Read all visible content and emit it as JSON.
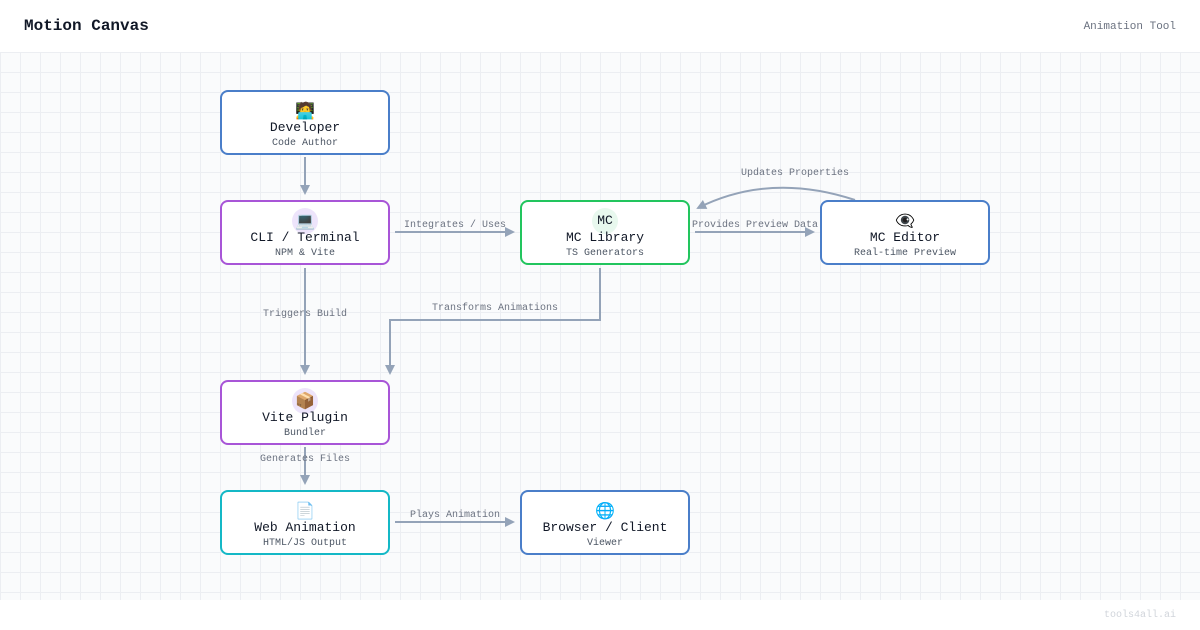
{
  "header": {
    "title": "Motion Canvas",
    "subtitle": "Animation Tool"
  },
  "footer": {
    "watermark": "tools4all.ai"
  },
  "nodes": {
    "developer": {
      "icon": "🧑‍💻",
      "icon_name": "developer-icon",
      "name": "Developer",
      "desc": "Code Author"
    },
    "cli": {
      "icon": "💻",
      "icon_name": "laptop-icon",
      "name": "CLI / Terminal",
      "desc": "NPM & Vite"
    },
    "library": {
      "icon": "MC",
      "icon_name": "mc-logo-icon",
      "name": "MC Library",
      "desc": "TS Generators"
    },
    "editor": {
      "icon": "👁‍🗨",
      "icon_name": "eye-icon",
      "name": "MC Editor",
      "desc": "Real-time Preview"
    },
    "vite": {
      "icon": "📦",
      "icon_name": "package-icon",
      "name": "Vite Plugin",
      "desc": "Bundler"
    },
    "web": {
      "icon": "📄",
      "icon_name": "document-icon",
      "name": "Web Animation",
      "desc": "HTML/JS Output"
    },
    "browser": {
      "icon": "🌐",
      "icon_name": "globe-icon",
      "name": "Browser / Client",
      "desc": "Viewer"
    }
  },
  "edges": {
    "integrates": "Integrates / Uses",
    "provides": "Provides Preview Data",
    "updates": "Updates Properties",
    "triggers": "Triggers Build",
    "transforms": "Transforms Animations",
    "generates": "Generates Files",
    "plays": "Plays Animation"
  },
  "colors": {
    "blue": "#4a7ec9",
    "purple": "#a855d7",
    "green": "#22c55e",
    "teal": "#14b8c6",
    "edge": "#94a3b8"
  }
}
